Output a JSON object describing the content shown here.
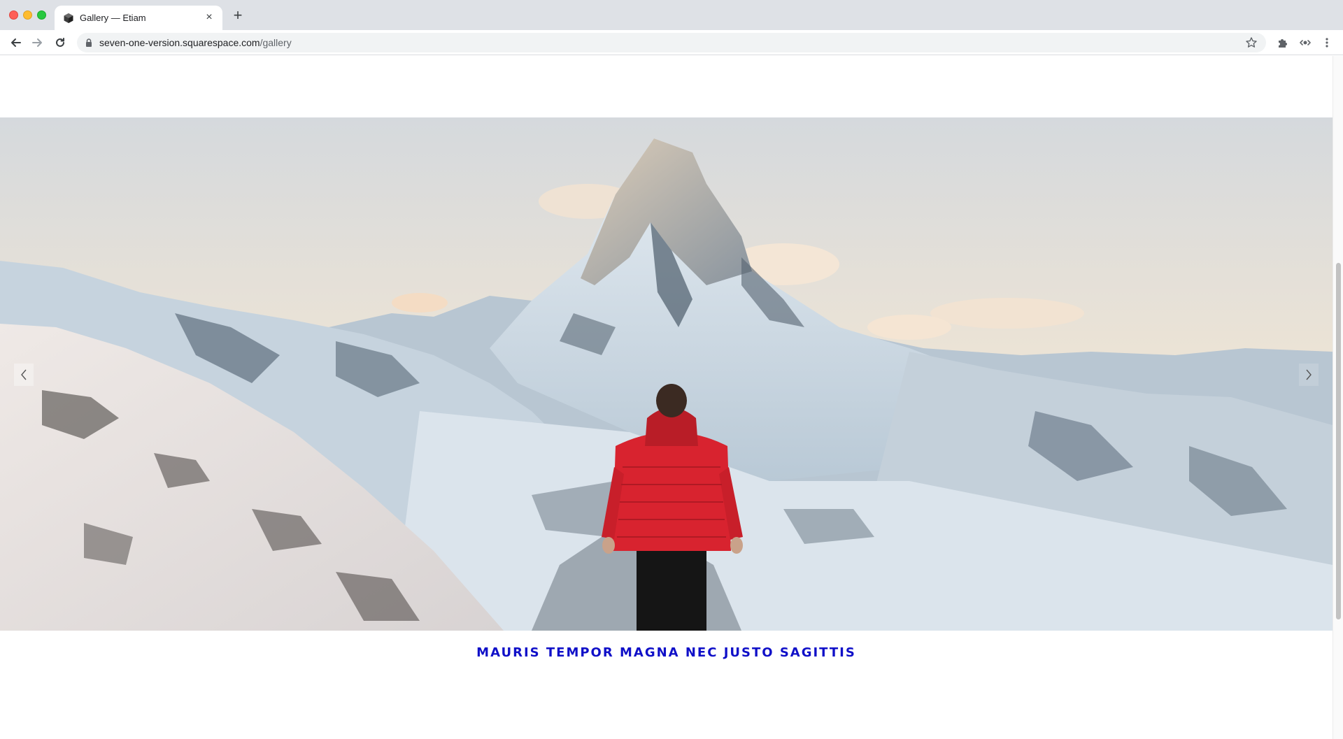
{
  "browser": {
    "tab": {
      "title": "Gallery — Etiam",
      "close_glyph": "×",
      "favicon": "cube-icon"
    },
    "new_tab_glyph": "+",
    "url": {
      "host": "seven-one-version.squarespace.com",
      "path": "/gallery"
    },
    "icons": {
      "back": "arrow-left-icon",
      "forward": "arrow-right-icon",
      "reload": "reload-icon",
      "lock": "lock-icon",
      "bookmark": "star-icon",
      "extensions": "puzzle-icon",
      "extension": "extension-icon",
      "menu": "kebab-menu-icon"
    }
  },
  "gallery": {
    "slide": {
      "image": "snowy-mountain-peak-hiker-red-jacket",
      "prev_glyph": "‹",
      "next_glyph": "›"
    },
    "caption": "MAURIS TEMPOR MAGNA NEC JUSTO SAGITTIS"
  },
  "colors": {
    "caption": "#1010c8",
    "tabbar": "#dee1e6",
    "omnibox": "#f1f3f4"
  }
}
